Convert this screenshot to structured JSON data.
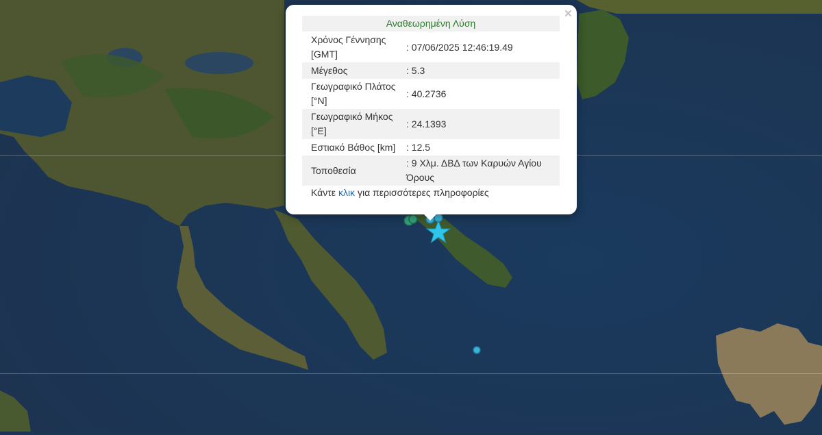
{
  "popup": {
    "title": "Αναθεωρημένη Λύση",
    "close_glyph": "×",
    "rows": [
      {
        "label": "Χρόνος Γέννησης [GMT]",
        "value": ": 07/06/2025 12:46:19.49"
      },
      {
        "label": "Μέγεθος",
        "value": ": 5.3"
      },
      {
        "label": "Γεωγραφικό Πλάτος [°N]",
        "value": ": 40.2736"
      },
      {
        "label": "Γεωγραφικό Μήκος [°E]",
        "value": ": 24.1393"
      },
      {
        "label": "Εστιακό Βάθος [km]",
        "value": ": 12.5"
      },
      {
        "label": "Τοποθεσία",
        "value": ": 9 Χλμ. ΔΒΔ των Καρυών Αγίου Όρους"
      }
    ],
    "footer_prefix": "Κάντε",
    "footer_link": "κλικ",
    "footer_suffix": "για περισσότερες πληροφορίες"
  },
  "markers": {
    "epicenter_icon": "star-icon",
    "epicenter_color": "#2fc6ec",
    "event_color_recent": "#3bb3d8",
    "event_color_older": "#35a07a"
  },
  "colors": {
    "sea": "#1b3553",
    "land": "#4d5530",
    "title_green": "#2c7c2c",
    "link_blue": "#1e6ab5"
  }
}
